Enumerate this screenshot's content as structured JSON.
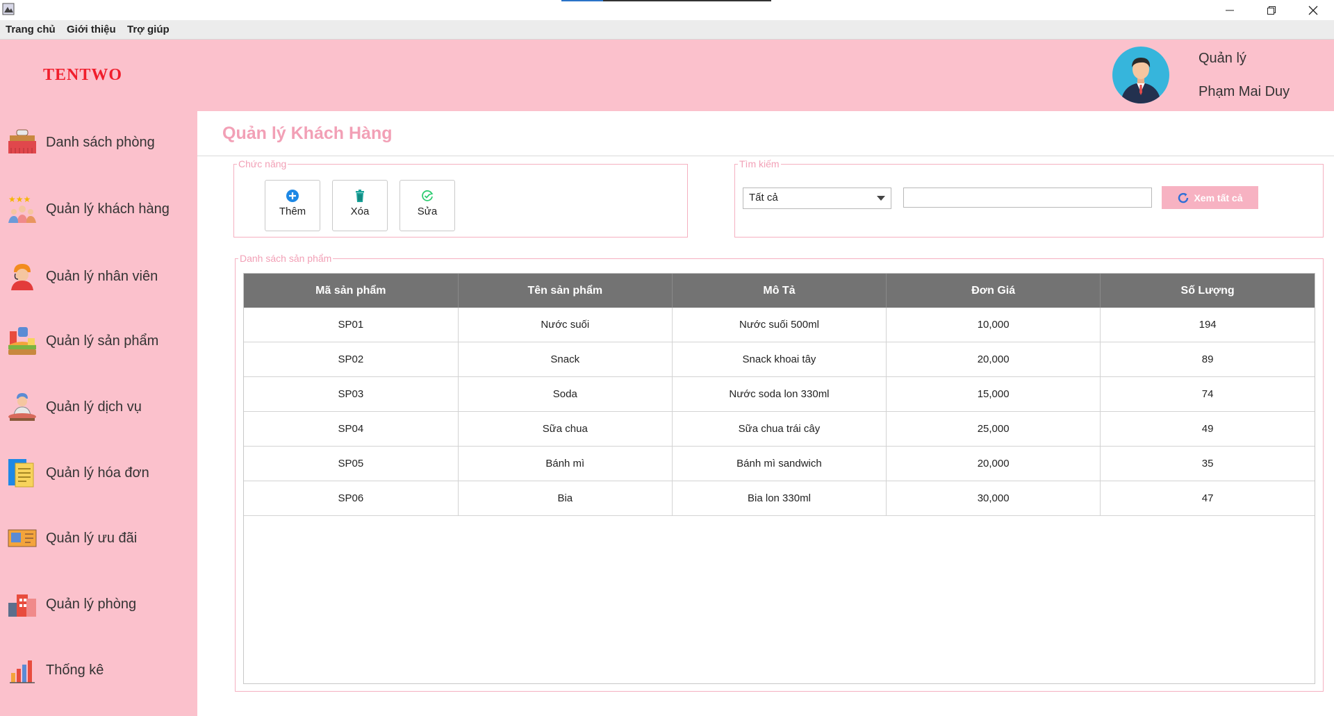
{
  "window": {
    "close_glyph": "✕",
    "minimize_glyph": "—",
    "maximize_glyph": "❐"
  },
  "menu": [
    "Trang chủ",
    "Giới thiệu",
    "Trợ giúp"
  ],
  "header": {
    "brand": "TENTWO",
    "role": "Quản lý",
    "user_name": "Phạm Mai Duy",
    "brand_color": "#f01e2c",
    "bg_color": "#fbc1cc"
  },
  "sidebar": [
    {
      "label": "Danh sách phòng",
      "icon": "bed-icon"
    },
    {
      "label": "Quản lý khách hàng",
      "icon": "customers-icon"
    },
    {
      "label": "Quản lý nhân viên",
      "icon": "staff-icon"
    },
    {
      "label": "Quản lý sản phẩm",
      "icon": "products-icon"
    },
    {
      "label": "Quản lý dịch vụ",
      "icon": "service-icon"
    },
    {
      "label": "Quản lý hóa đơn",
      "icon": "invoice-icon"
    },
    {
      "label": "Quản lý ưu đãi",
      "icon": "voucher-icon"
    },
    {
      "label": "Quản lý phòng",
      "icon": "rooms-icon"
    },
    {
      "label": "Thống kê",
      "icon": "chart-icon"
    }
  ],
  "main": {
    "title": "Quản lý Khách Hàng",
    "functions_legend": "Chức năng",
    "buttons": {
      "add": "Thêm",
      "delete": "Xóa",
      "edit": "Sửa"
    },
    "search_legend": "Tìm kiếm",
    "filter_value": "Tất cả",
    "search_value": "",
    "view_all": "Xem tất cả",
    "table_legend": "Danh sách sản phẩm",
    "table": {
      "columns": [
        "Mã sản phẩm",
        "Tên sản phẩm",
        "Mô Tả",
        "Đơn Giá",
        "Số Lượng"
      ],
      "rows": [
        [
          "SP01",
          "Nước suối",
          "Nước suối 500ml",
          "10,000",
          "194"
        ],
        [
          "SP02",
          "Snack",
          "Snack khoai tây",
          "20,000",
          "89"
        ],
        [
          "SP03",
          "Soda",
          "Nước soda lon 330ml",
          "15,000",
          "74"
        ],
        [
          "SP04",
          "Sữa chua",
          "Sữa chua trái cây",
          "25,000",
          "49"
        ],
        [
          "SP05",
          "Bánh mì",
          "Bánh mì sandwich",
          "20,000",
          "35"
        ],
        [
          "SP06",
          "Bia",
          "Bia lon 330ml",
          "30,000",
          "47"
        ]
      ]
    }
  }
}
